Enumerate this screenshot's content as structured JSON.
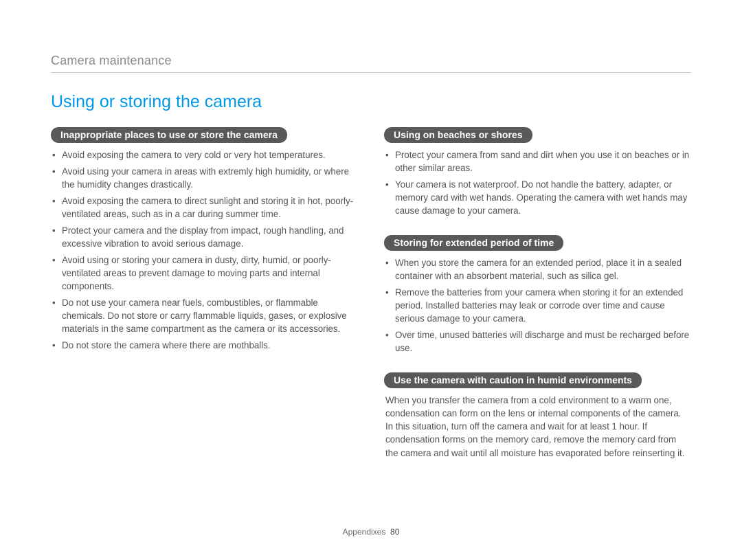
{
  "breadcrumb": "Camera maintenance",
  "heading": "Using or storing the camera",
  "left": {
    "section1": {
      "title": "Inappropriate places to use or store the camera",
      "items": [
        "Avoid exposing the camera to very cold or very hot temperatures.",
        "Avoid using your camera in areas with extremly high humidity, or where the humidity changes drastically.",
        "Avoid exposing the camera to direct sunlight and storing it in hot, poorly-ventilated areas, such as in a car during summer time.",
        "Protect your camera and the display from impact, rough handling, and excessive vibration to avoid serious damage.",
        "Avoid using or storing your camera in dusty, dirty, humid, or poorly-ventilated areas to prevent damage to moving parts and internal components.",
        "Do not use your camera near fuels, combustibles, or flammable chemicals. Do not store or carry flammable liquids, gases, or explosive materials in the same compartment as the camera or its accessories.",
        "Do not store the camera where there are mothballs."
      ]
    }
  },
  "right": {
    "section1": {
      "title": "Using on beaches or shores",
      "items": [
        "Protect your camera from sand and dirt when you use it on beaches or in other similar areas.",
        "Your camera is not waterproof. Do not handle the battery, adapter, or memory card with wet hands. Operating the camera with wet hands may cause damage to your camera."
      ]
    },
    "section2": {
      "title": "Storing for extended period of time",
      "items": [
        "When you store the camera for an extended period, place it in a sealed container with an absorbent material, such as silica gel.",
        "Remove the batteries from your camera when storing it for an extended period. Installed batteries may leak or corrode over time and cause serious damage to your camera.",
        "Over time, unused batteries will discharge and must be recharged before use."
      ]
    },
    "section3": {
      "title": "Use the camera with caution in humid environments",
      "body": "When you transfer the camera from a cold environment to a warm one, condensation can form on the lens or internal components of the camera. In this situation, turn off the camera and wait for at least 1 hour. If condensation forms on the memory card, remove the memory card from the camera and wait until all moisture has evaporated before reinserting it."
    }
  },
  "footer": {
    "section": "Appendixes",
    "page": "80"
  }
}
